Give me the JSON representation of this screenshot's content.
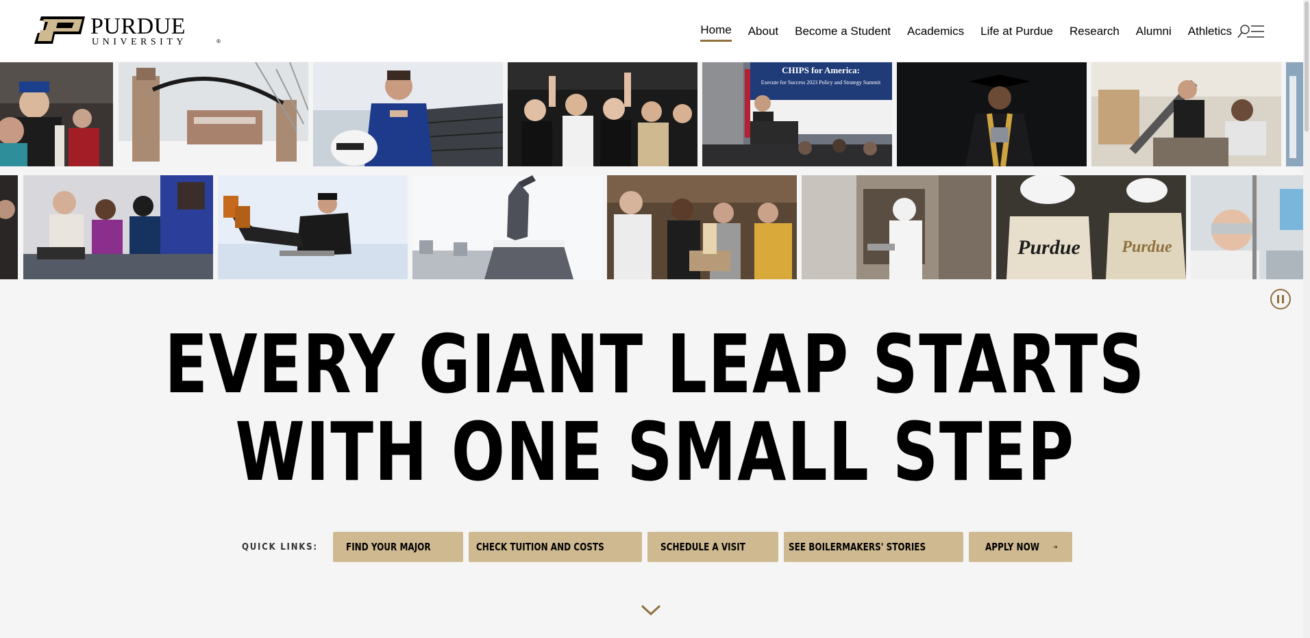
{
  "logo": {
    "line1": "PURDUE",
    "line2": "UNIVERSITY",
    "mark": "®"
  },
  "nav": {
    "items": [
      {
        "label": "Home",
        "active": true
      },
      {
        "label": "About"
      },
      {
        "label": "Become a Student"
      },
      {
        "label": "Academics"
      },
      {
        "label": "Life at Purdue"
      },
      {
        "label": "Research"
      },
      {
        "label": "Alumni"
      },
      {
        "label": "Athletics"
      }
    ],
    "search_menu_icon": "search-menu-icon"
  },
  "photos": {
    "row1": [
      "graduation-celebration-photo",
      "purdue-gateway-snow-photo",
      "race-driver-photo",
      "student-section-fans-photo",
      "chips-for-america-summit-photo",
      "graduate-portrait-photo",
      "engineering-lab-photo"
    ],
    "row2": [
      "maker-lab-students-photo",
      "sledding-student-photo",
      "boilermaker-statue-snow-photo",
      "students-lounge-photo",
      "cleanroom-researcher-photo",
      "marching-band-photo",
      "lab-safety-goggles-photo"
    ],
    "summit_banner_title": "CHIPS for America:",
    "summit_banner_sub": "Execute for Success 2023 Policy and Strategy Summit",
    "band_jacket_text": "Purdue"
  },
  "hero": {
    "headline_line1": "EVERY GIANT LEAP STARTS",
    "headline_line2": "WITH ONE SMALL STEP",
    "pause_icon": "pause-icon"
  },
  "quick_links": {
    "label": "QUICK LINKS:",
    "items": [
      {
        "label": "FIND YOUR MAJOR"
      },
      {
        "label": "CHECK TUITION AND COSTS"
      },
      {
        "label": "SCHEDULE A VISIT"
      },
      {
        "label": "SEE BOILERMAKERS' STORIES"
      },
      {
        "label": "APPLY NOW"
      }
    ]
  },
  "colors": {
    "gold": "#cfb991",
    "dark_gold": "#8e6f3e",
    "black": "#000000",
    "background": "#f5f5f5"
  }
}
